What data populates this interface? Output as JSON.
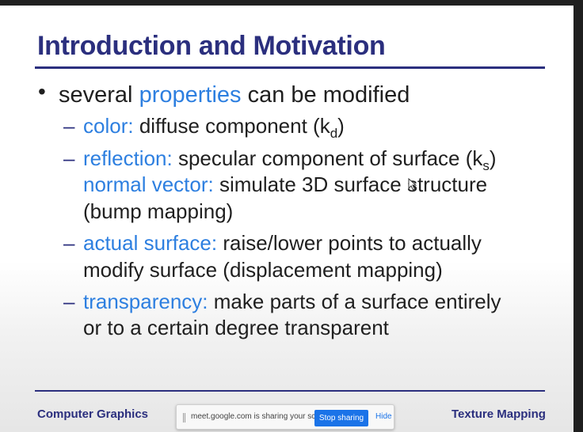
{
  "slide": {
    "title": "Introduction and Motivation",
    "bullet": {
      "marker": "•",
      "prefix": "several",
      "highlight": "properties",
      "suffix": "can be modified"
    },
    "items": [
      {
        "dash": "–",
        "lines": [
          {
            "hl": "color:",
            "text": "diffuse component (k",
            "sub": "d",
            "tail": ")"
          }
        ]
      },
      {
        "dash": "–",
        "lines": [
          {
            "hl": "reflection:",
            "text": "specular component of surface (k",
            "sub": "s",
            "tail": ")"
          },
          {
            "hl": "normal vector:",
            "text": "simulate 3D surface structure"
          },
          {
            "text": "(bump mapping)"
          }
        ]
      },
      {
        "dash": "–",
        "lines": [
          {
            "hl": "actual surface:",
            "text": "raise/lower points to actually"
          },
          {
            "text": "modify surface (displacement mapping)"
          }
        ]
      },
      {
        "dash": "–",
        "lines": [
          {
            "hl": "transparency:",
            "text": "make parts of a surface entirely"
          },
          {
            "text": "or to a certain degree transparent"
          }
        ]
      }
    ],
    "footer": {
      "left": "Computer Graphics",
      "right": "Texture Mapping"
    }
  },
  "share_bar": {
    "message": "meet.google.com is sharing your screen.",
    "stop_label": "Stop sharing",
    "hide_label": "Hide"
  },
  "colors": {
    "title": "#2b2f7e",
    "highlight": "#2d7fe0",
    "body": "#1f1f1f",
    "button": "#1a73e8"
  },
  "icons": [
    "bullet-dot-icon",
    "dash-icon",
    "drag-grip-icon",
    "mouse-cursor-icon"
  ]
}
